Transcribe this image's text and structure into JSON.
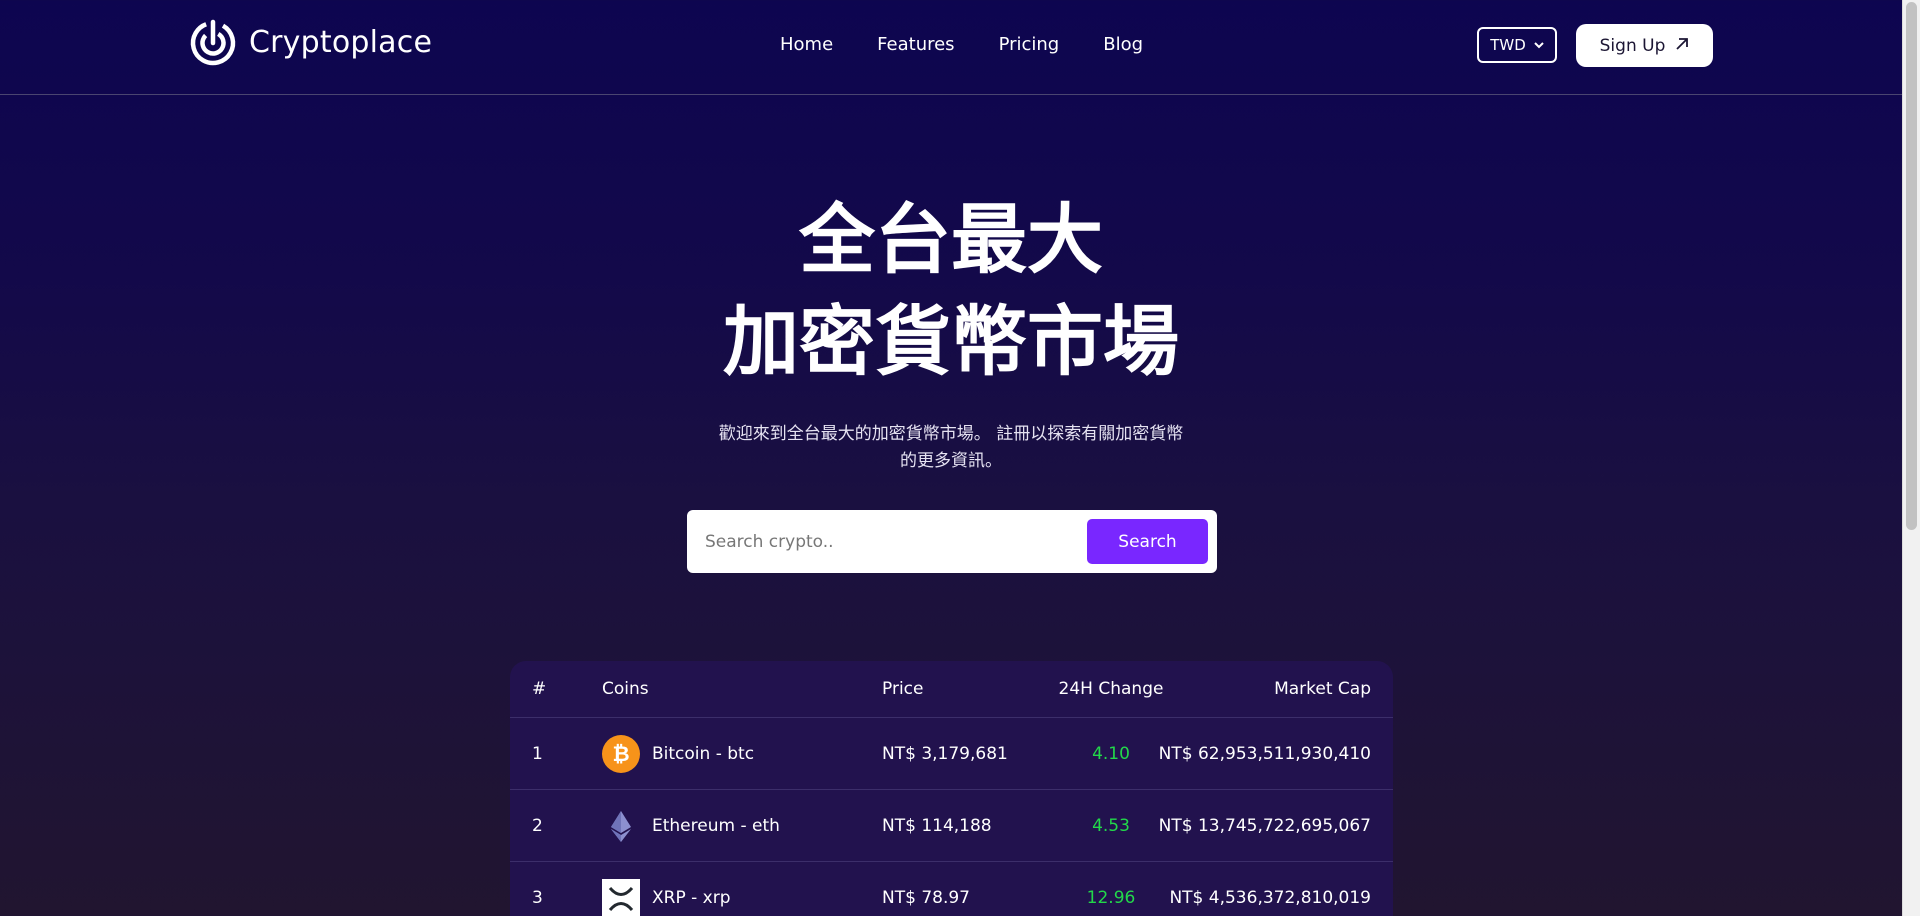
{
  "brand": {
    "name": "Cryptoplace"
  },
  "nav": {
    "items": [
      "Home",
      "Features",
      "Pricing",
      "Blog"
    ]
  },
  "currency": {
    "selected": "TWD"
  },
  "signup": {
    "label": "Sign Up"
  },
  "hero": {
    "title_line1": "全台最大",
    "title_line2": "加密貨幣市場",
    "subtitle_line1": "歡迎來到全台最大的加密貨幣市場。 註冊以探索有關加密貨幣",
    "subtitle_line2": "的更多資訊。"
  },
  "search": {
    "placeholder": "Search crypto..",
    "button_label": "Search"
  },
  "table": {
    "headers": {
      "rank": "#",
      "coins": "Coins",
      "price": "Price",
      "change": "24H Change",
      "market_cap": "Market Cap"
    },
    "rows": [
      {
        "rank": "1",
        "coin": "Bitcoin - btc",
        "icon": "bitcoin-icon",
        "price": "NT$ 3,179,681",
        "change": "4.10",
        "market_cap": "NT$ 62,953,511,930,410"
      },
      {
        "rank": "2",
        "coin": "Ethereum - eth",
        "icon": "ethereum-icon",
        "price": "NT$ 114,188",
        "change": "4.53",
        "market_cap": "NT$ 13,745,722,695,067"
      },
      {
        "rank": "3",
        "coin": "XRP - xrp",
        "icon": "xrp-icon",
        "price": "NT$ 78.97",
        "change": "12.96",
        "market_cap": "NT$ 4,536,372,810,019"
      }
    ]
  },
  "colors": {
    "accent": "#7927ff",
    "positive": "#22d84a",
    "bitcoin": "#f7931a"
  }
}
